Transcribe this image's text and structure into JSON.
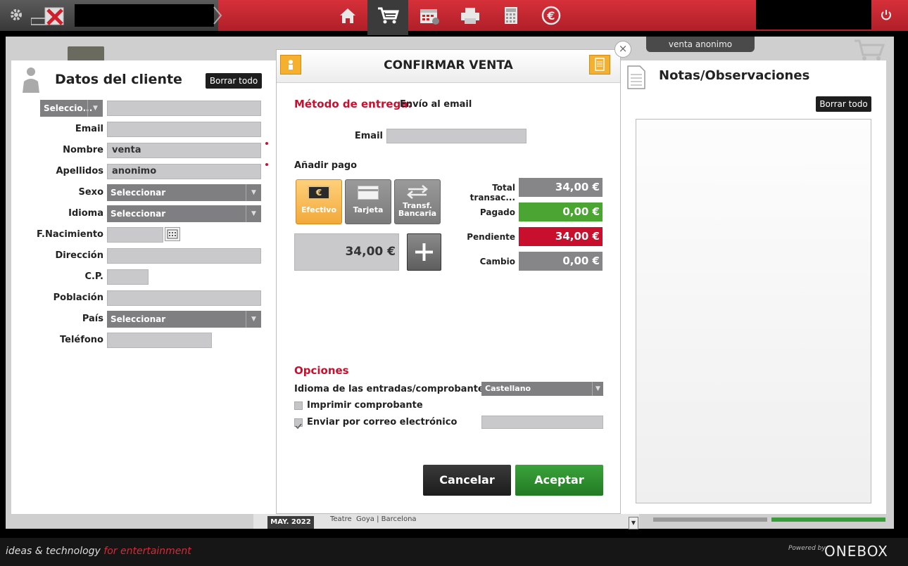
{
  "topbar": {
    "nav_icons": [
      "home-icon",
      "cart-icon",
      "calendar-icon",
      "printer-icon",
      "calculator-icon",
      "euro-icon"
    ]
  },
  "background": {
    "user_badge": "venta anonimo",
    "event_date": "MAY. 2022",
    "event_venue": "Teatre  Goya | Barcelona"
  },
  "customer": {
    "title": "Datos del cliente",
    "clear_label": "Borrar todo",
    "id_type_select": "Seleccio...",
    "fields": {
      "email_label": "Email",
      "nombre_label": "Nombre",
      "nombre_value": "venta",
      "apellidos_label": "Apellidos",
      "apellidos_value": "anonimo",
      "sexo_label": "Sexo",
      "sexo_value": "Seleccionar",
      "idioma_label": "Idioma",
      "idioma_value": "Seleccionar",
      "fnac_label": "F.Nacimiento",
      "direccion_label": "Dirección",
      "cp_label": "C.P.",
      "poblacion_label": "Población",
      "pais_label": "País",
      "pais_value": "Seleccionar",
      "telefono_label": "Teléfono"
    }
  },
  "confirm": {
    "title": "CONFIRMAR VENTA",
    "delivery_label": "Método de entrega:",
    "delivery_value": "Envío al email",
    "email_label": "Email",
    "add_payment_label": "Añadir pago",
    "pay_methods": {
      "cash": "Efectivo",
      "card": "Tarjeta",
      "transfer_line1": "Transf.",
      "transfer_line2": "Bancaria"
    },
    "amount_input": "34,00 €",
    "summary": {
      "total_label": "Total transac...",
      "total_value": "34,00 €",
      "paid_label": "Pagado",
      "paid_value": "0,00 €",
      "pending_label": "Pendiente",
      "pending_value": "34,00 €",
      "change_label": "Cambio",
      "change_value": "0,00 €"
    },
    "options_title": "Opciones",
    "ticket_lang_label": "Idioma de las entradas/comprobante",
    "ticket_lang_value": "Castellano",
    "print_receipt_label": "Imprimir comprobante",
    "print_receipt_checked": false,
    "send_email_label": "Enviar por correo electrónico",
    "send_email_checked": true,
    "cancel_label": "Cancelar",
    "accept_label": "Aceptar"
  },
  "notes": {
    "title": "Notas/Observaciones",
    "clear_label": "Borrar todo"
  },
  "footer": {
    "tagline_prefix": "ideas & technology",
    "tagline_suffix": "for entertainment",
    "powered_by": "Powered by",
    "brand": "ONEBOX"
  },
  "colors": {
    "brand_red": "#c8102e",
    "paid_green": "#4aa532",
    "accept_green": "#2d8a2e",
    "cash_orange": "#f5b347"
  }
}
